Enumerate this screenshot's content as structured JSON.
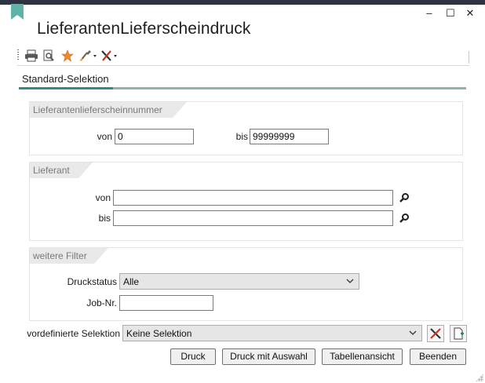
{
  "window": {
    "title": "LieferantenLieferscheindruck",
    "controls": {
      "minimize": "–",
      "maximize": "☐",
      "close": "✕"
    }
  },
  "toolbar": {
    "icons": [
      "printer-icon",
      "print-preview-icon",
      "favorite-star-icon",
      "brush-icon",
      "tools-icon"
    ]
  },
  "tabs": [
    {
      "label": "Standard-Selektion",
      "active": true
    }
  ],
  "groups": {
    "number": {
      "header": "Lieferantenlieferscheinnummer",
      "from_label": "von",
      "from_value": "0",
      "to_label": "bis",
      "to_value": "99999999"
    },
    "supplier": {
      "header": "Lieferant",
      "from_label": "von",
      "from_value": "",
      "to_label": "bis",
      "to_value": ""
    },
    "filters": {
      "header": "weitere Filter",
      "status_label": "Druckstatus",
      "status_value": "Alle",
      "job_label": "Job-Nr.",
      "job_value": ""
    }
  },
  "predefined": {
    "label": "vordefinierte Selektion",
    "value": "Keine Selektion"
  },
  "buttons": {
    "print": "Druck",
    "print_select": "Druck mit Auswahl",
    "table_view": "Tabellenansicht",
    "exit": "Beenden"
  },
  "colors": {
    "accent": "#2f8f83",
    "accent_light": "#8fb3ad",
    "titlebar": "#2b3440"
  }
}
